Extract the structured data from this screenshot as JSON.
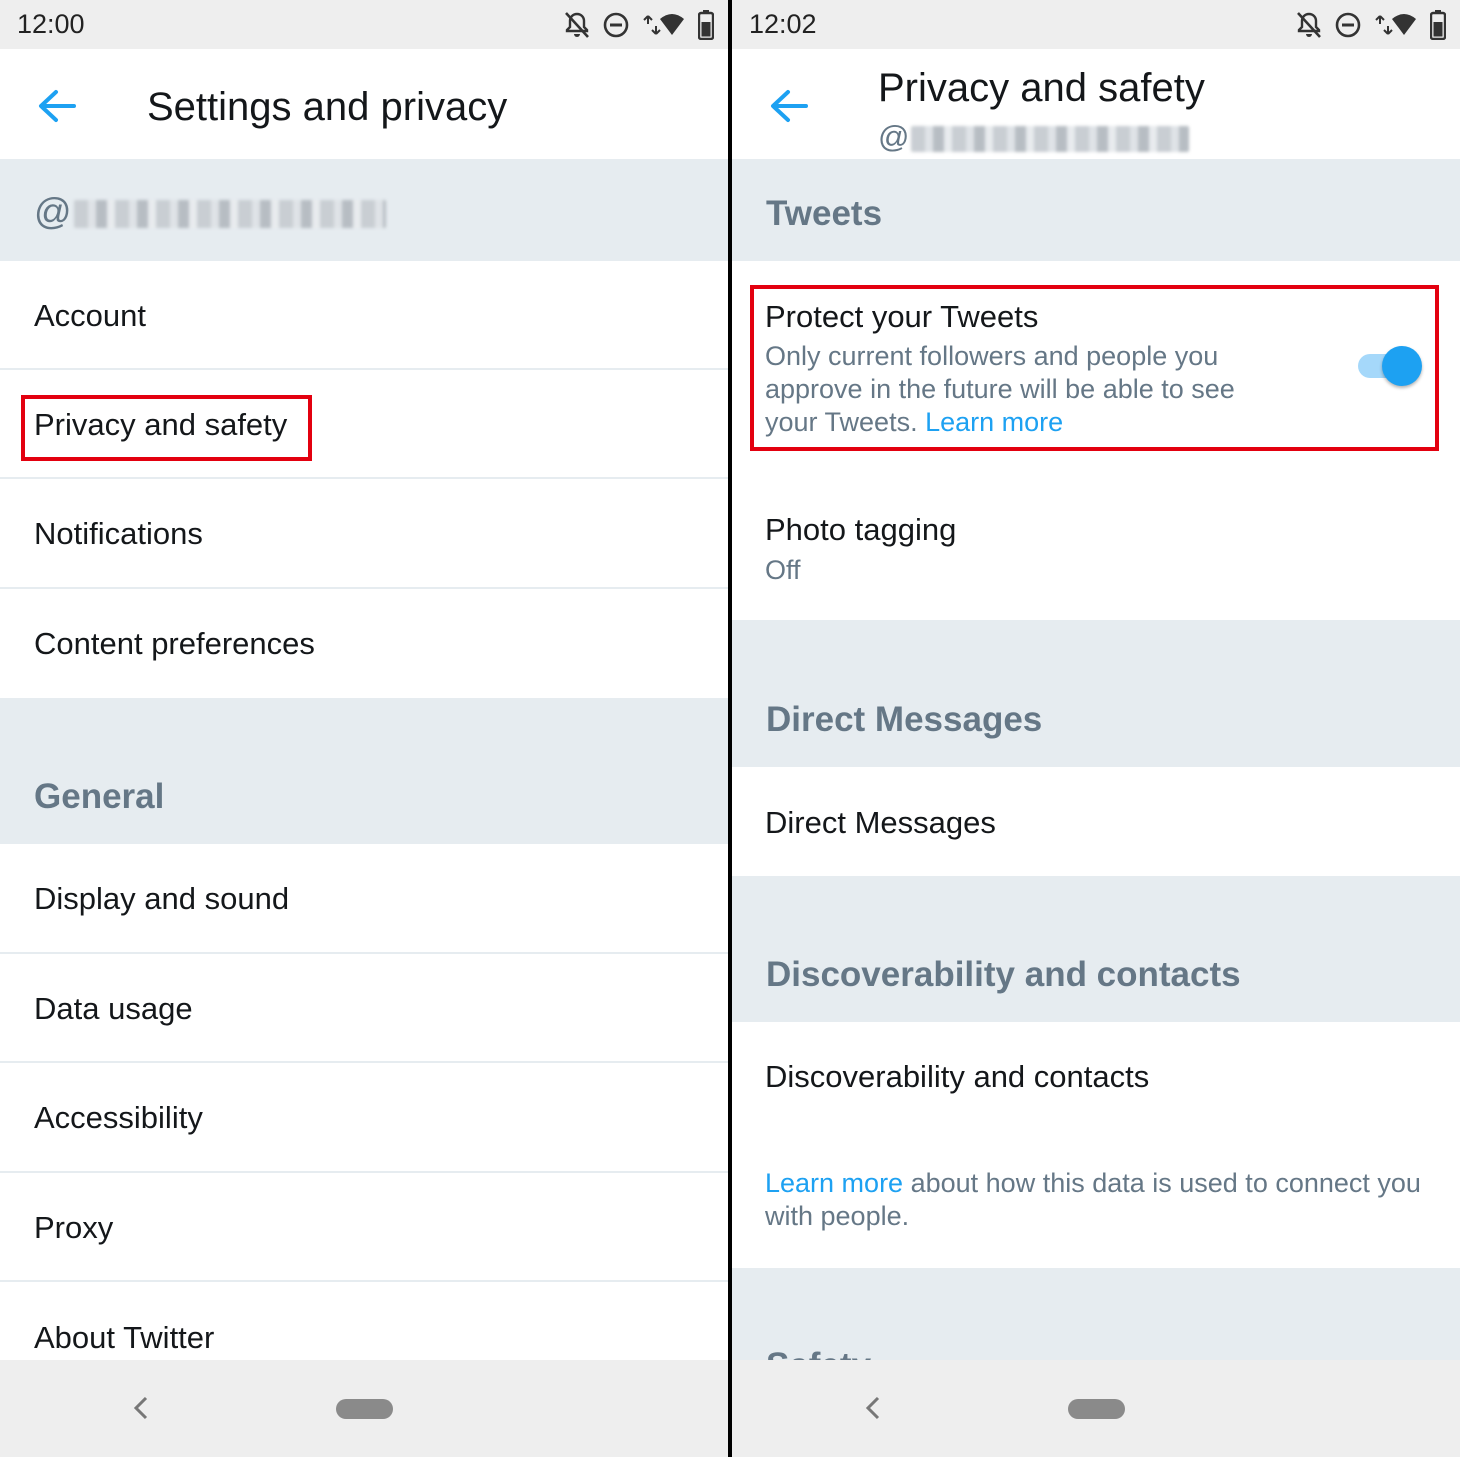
{
  "left": {
    "status_time": "12:00",
    "title": "Settings and privacy",
    "handle_prefix": "@",
    "account_items": [
      "Account",
      "Privacy and safety",
      "Notifications",
      "Content preferences"
    ],
    "general_header": "General",
    "general_items": [
      "Display and sound",
      "Data usage",
      "Accessibility",
      "Proxy",
      "About Twitter"
    ]
  },
  "right": {
    "status_time": "12:02",
    "title": "Privacy and safety",
    "handle_prefix": "@",
    "tweets_header": "Tweets",
    "protect": {
      "title": "Protect your Tweets",
      "description": "Only current followers and people you approve in the future will be able to see your Tweets.",
      "link": "Learn more",
      "enabled": true
    },
    "photo_tagging": {
      "title": "Photo tagging",
      "value": "Off"
    },
    "dm_header": "Direct Messages",
    "dm_item": "Direct Messages",
    "discover_header": "Discoverability and contacts",
    "discover_item": "Discoverability and contacts",
    "discover_note_link": "Learn more",
    "discover_note": "about how this data is used to connect you with people.",
    "next_header_partial": "Safety"
  },
  "colors": {
    "accent": "#1da1f2",
    "highlight": "#e3000f",
    "muted": "#657786",
    "section_bg": "#e6ecf0"
  },
  "icons": [
    "back-arrow-icon",
    "notifications-off-icon",
    "do-not-disturb-icon",
    "wifi-icon",
    "battery-icon",
    "nav-back-icon",
    "home-pill-icon"
  ]
}
